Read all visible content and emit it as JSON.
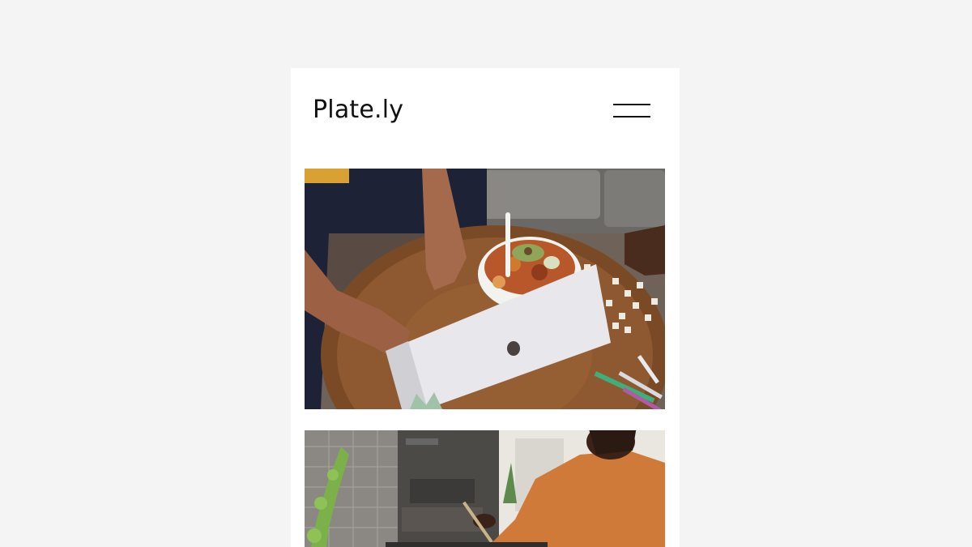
{
  "app": {
    "logo": "Plate.ly"
  },
  "header": {
    "menu_icon": "hamburger-menu-icon"
  },
  "feed": {
    "items": [
      {
        "image": "person-typing-on-laptop-with-food-bowl-photo"
      },
      {
        "image": "woman-cooking-in-kitchen-photo"
      }
    ]
  },
  "colors": {
    "page_background": "#f4f4f4",
    "card_background": "#ffffff",
    "text": "#111111"
  }
}
